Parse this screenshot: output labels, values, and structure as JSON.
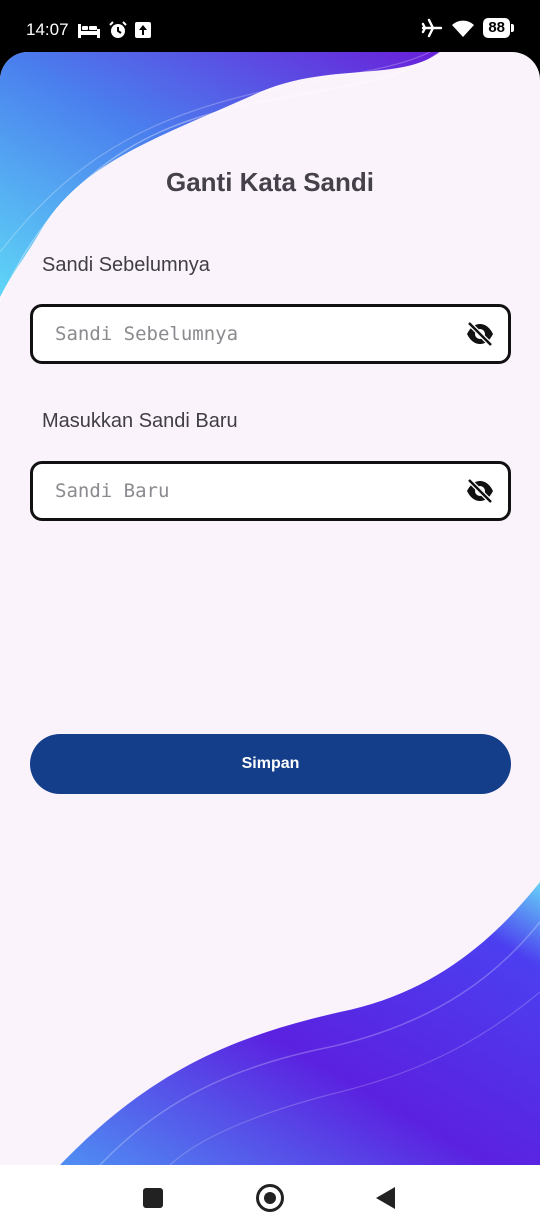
{
  "status_bar": {
    "time": "14:07",
    "battery": "88",
    "left_icons": [
      "bed-icon",
      "alarm-icon",
      "upload-icon"
    ],
    "right_icons": [
      "airplane-icon",
      "wifi-icon"
    ]
  },
  "page": {
    "title": "Ganti Kata Sandi"
  },
  "form": {
    "old_password": {
      "label": "Sandi Sebelumnya",
      "placeholder": "Sandi Sebelumnya",
      "value": "",
      "toggle_icon": "eye-off-icon"
    },
    "new_password": {
      "label": "Masukkan Sandi Baru",
      "placeholder": "Sandi Baru",
      "value": "",
      "toggle_icon": "eye-off-icon"
    },
    "save_label": "Simpan"
  },
  "nav_bar": {
    "icons": [
      "recents-icon",
      "home-icon",
      "back-icon"
    ]
  },
  "colors": {
    "background": "#fbf3fc",
    "primary_button": "#143e8a",
    "title_text": "#45414a",
    "wave_purple": "#5b21e0",
    "wave_cyan": "#5fd6f6"
  }
}
